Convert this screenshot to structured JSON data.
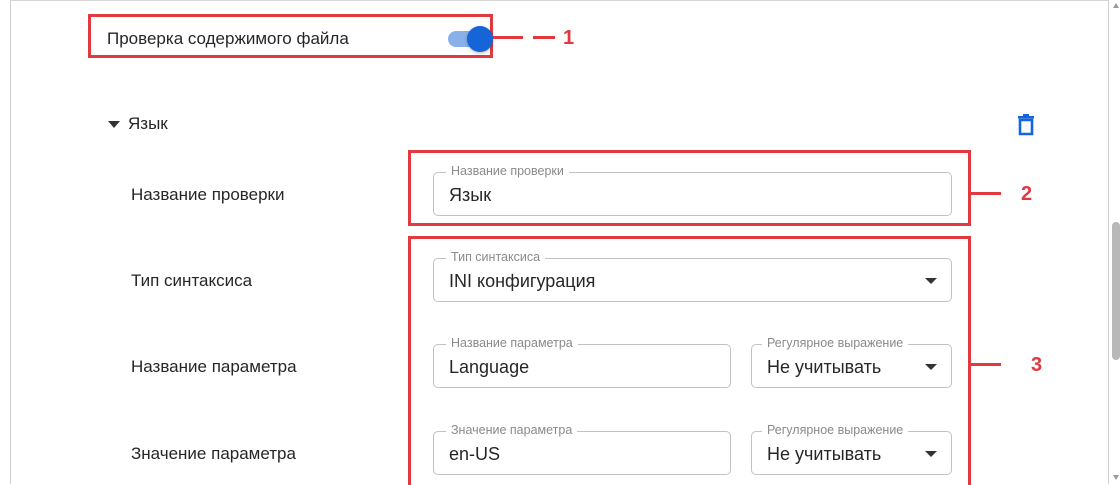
{
  "content_check": {
    "label": "Проверка содержимого файла",
    "enabled": true
  },
  "section": {
    "title": "Язык"
  },
  "rows": {
    "check_name": {
      "label": "Название проверки",
      "legend": "Название проверки",
      "value": "Язык"
    },
    "syntax_type": {
      "label": "Тип синтаксиса",
      "legend": "Тип синтаксиса",
      "value": "INI конфигурация"
    },
    "param_name": {
      "label": "Название параметра",
      "legend": "Название параметра",
      "value": "Language",
      "regex_legend": "Регулярное выражение",
      "regex_value": "Не учитывать"
    },
    "param_value": {
      "label": "Значение параметра",
      "legend": "Значение параметра",
      "value": "en-US",
      "regex_legend": "Регулярное выражение",
      "regex_value": "Не учитывать"
    }
  },
  "callouts": [
    "1",
    "2",
    "3"
  ],
  "icons": {
    "delete": "trash-icon",
    "expand": "caret-down-icon",
    "dropdown": "dropdown-arrow-icon"
  },
  "colors": {
    "accent": "#1565d8",
    "callout": "#e0393e"
  }
}
